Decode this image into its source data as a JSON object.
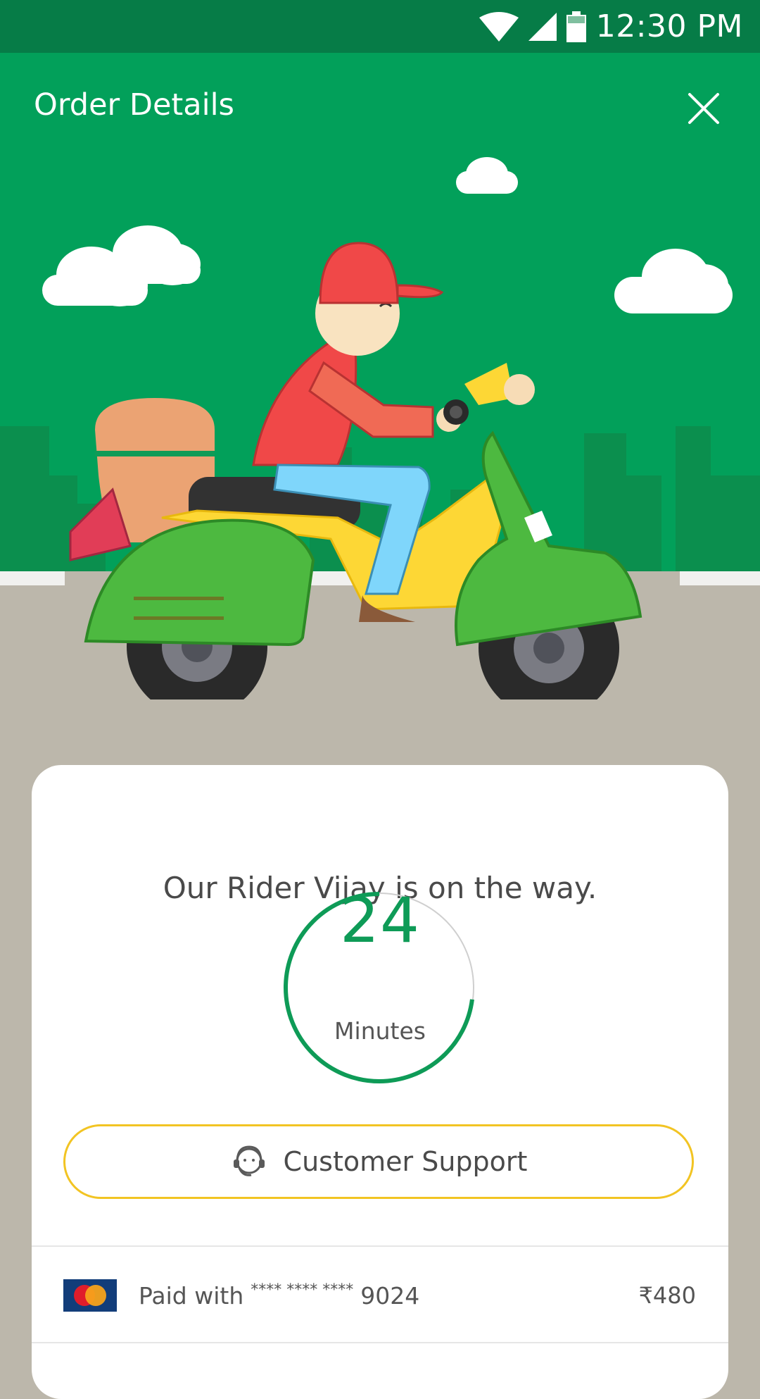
{
  "status_bar": {
    "time": "12:30 PM",
    "icons": [
      "wifi-icon",
      "signal-icon",
      "battery-icon"
    ]
  },
  "header": {
    "title": "Order Details",
    "close_icon": "close-icon"
  },
  "delivery": {
    "message": "Our Rider Vijay is on the way.",
    "eta_value": "24",
    "eta_unit": "Minutes",
    "eta_progress_fraction": 0.27
  },
  "support": {
    "label": "Customer Support",
    "icon": "headset-agent-icon"
  },
  "payment": {
    "prefix": "Paid with",
    "card_mask": "**** **** ****",
    "card_last4": "9024",
    "amount": "₹480",
    "card_brand_icon": "mastercard-icon"
  },
  "colors": {
    "status_bar": "#067c47",
    "hero_green": "#02a05a",
    "accent_green": "#0e9b57",
    "support_border": "#f2c423",
    "road": "#bcb7ab"
  }
}
